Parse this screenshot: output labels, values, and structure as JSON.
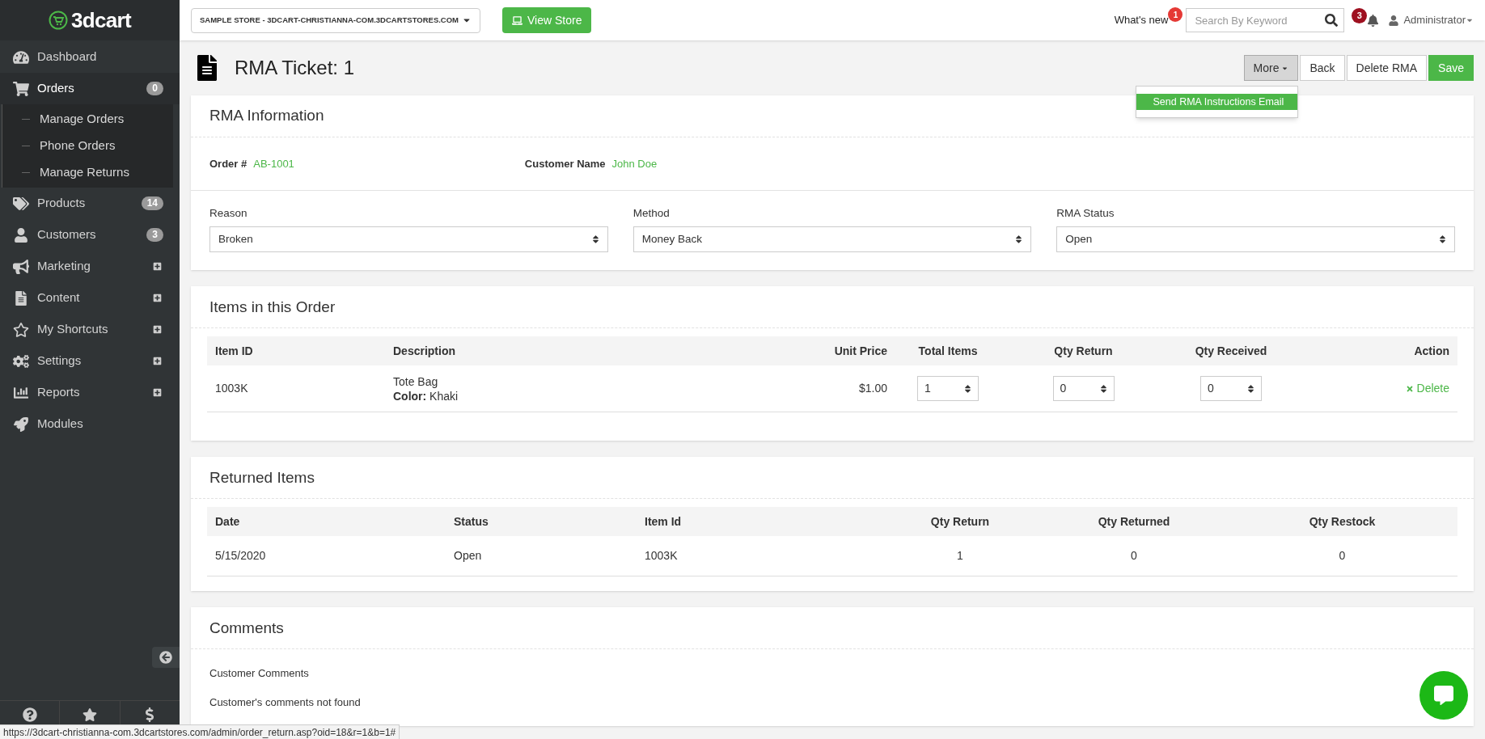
{
  "logo": {
    "text": "3dcart"
  },
  "store_select": {
    "value": "SAMPLE STORE - 3DCART-CHRISTIANNA-COM.3DCARTSTORES.COM"
  },
  "view_store": "View Store",
  "whats_new": {
    "label": "What's new",
    "count": "1"
  },
  "search": {
    "placeholder": "Search By Keyword"
  },
  "notifications": {
    "count": "3"
  },
  "user": "Administrator",
  "sidebar": {
    "items": [
      {
        "label": "Dashboard"
      },
      {
        "label": "Orders",
        "badge": "0",
        "expanded": true,
        "children": [
          {
            "label": "Manage Orders"
          },
          {
            "label": "Phone Orders"
          },
          {
            "label": "Manage Returns"
          }
        ]
      },
      {
        "label": "Products",
        "badge": "14"
      },
      {
        "label": "Customers",
        "badge": "3"
      },
      {
        "label": "Marketing",
        "expanded": false
      },
      {
        "label": "Content",
        "expanded": false
      },
      {
        "label": "My Shortcuts",
        "expanded": false
      },
      {
        "label": "Settings",
        "expanded": false
      },
      {
        "label": "Reports",
        "expanded": false
      },
      {
        "label": "Modules"
      }
    ]
  },
  "page_title": "RMA Ticket: 1",
  "actions": [
    {
      "label": "More",
      "kind": "menu",
      "expanded": true
    },
    {
      "label": "Back",
      "kind": "plain"
    },
    {
      "label": "Delete RMA",
      "kind": "plain"
    },
    {
      "label": "Save",
      "kind": "primary"
    }
  ],
  "more_menu": [
    {
      "label": "Send RMA Instructions Email",
      "selected": true
    }
  ],
  "rma_info": {
    "title": "RMA Information",
    "order_label": "Order #",
    "order": "AB-1001",
    "customer_label": "Customer Name",
    "customer": "John Doe",
    "selects": [
      {
        "label": "Reason",
        "value": "Broken"
      },
      {
        "label": "Method",
        "value": "Money Back"
      },
      {
        "label": "RMA Status",
        "value": "Open"
      }
    ]
  },
  "items": {
    "title": "Items in this Order",
    "columns": [
      "Item ID",
      "Description",
      "Unit Price",
      "Total Items",
      "Qty Return",
      "Qty Received",
      "Action"
    ],
    "rows": [
      {
        "item_id": "1003K",
        "description": "Tote Bag",
        "option": "**Color:** Khaki",
        "unit_price": "$1.00",
        "total_items": "1",
        "qty_return": "0",
        "qty_received": "0",
        "action": "Delete"
      }
    ]
  },
  "returned": {
    "title": "Returned Items",
    "columns": [
      "Date",
      "Status",
      "Item Id",
      "Qty Return",
      "Qty Returned",
      "Qty Restock"
    ],
    "rows": [
      [
        "5/15/2020",
        "Open",
        "1003K",
        "1",
        "0",
        "0"
      ]
    ]
  },
  "comments": {
    "title": "Comments",
    "label": "Customer Comments",
    "text": "Customer's comments not found"
  },
  "status_url": "https://3dcart-christianna-com.3dcartstores.com/admin/order_return.asp?oid=18&r=1&b=1#"
}
